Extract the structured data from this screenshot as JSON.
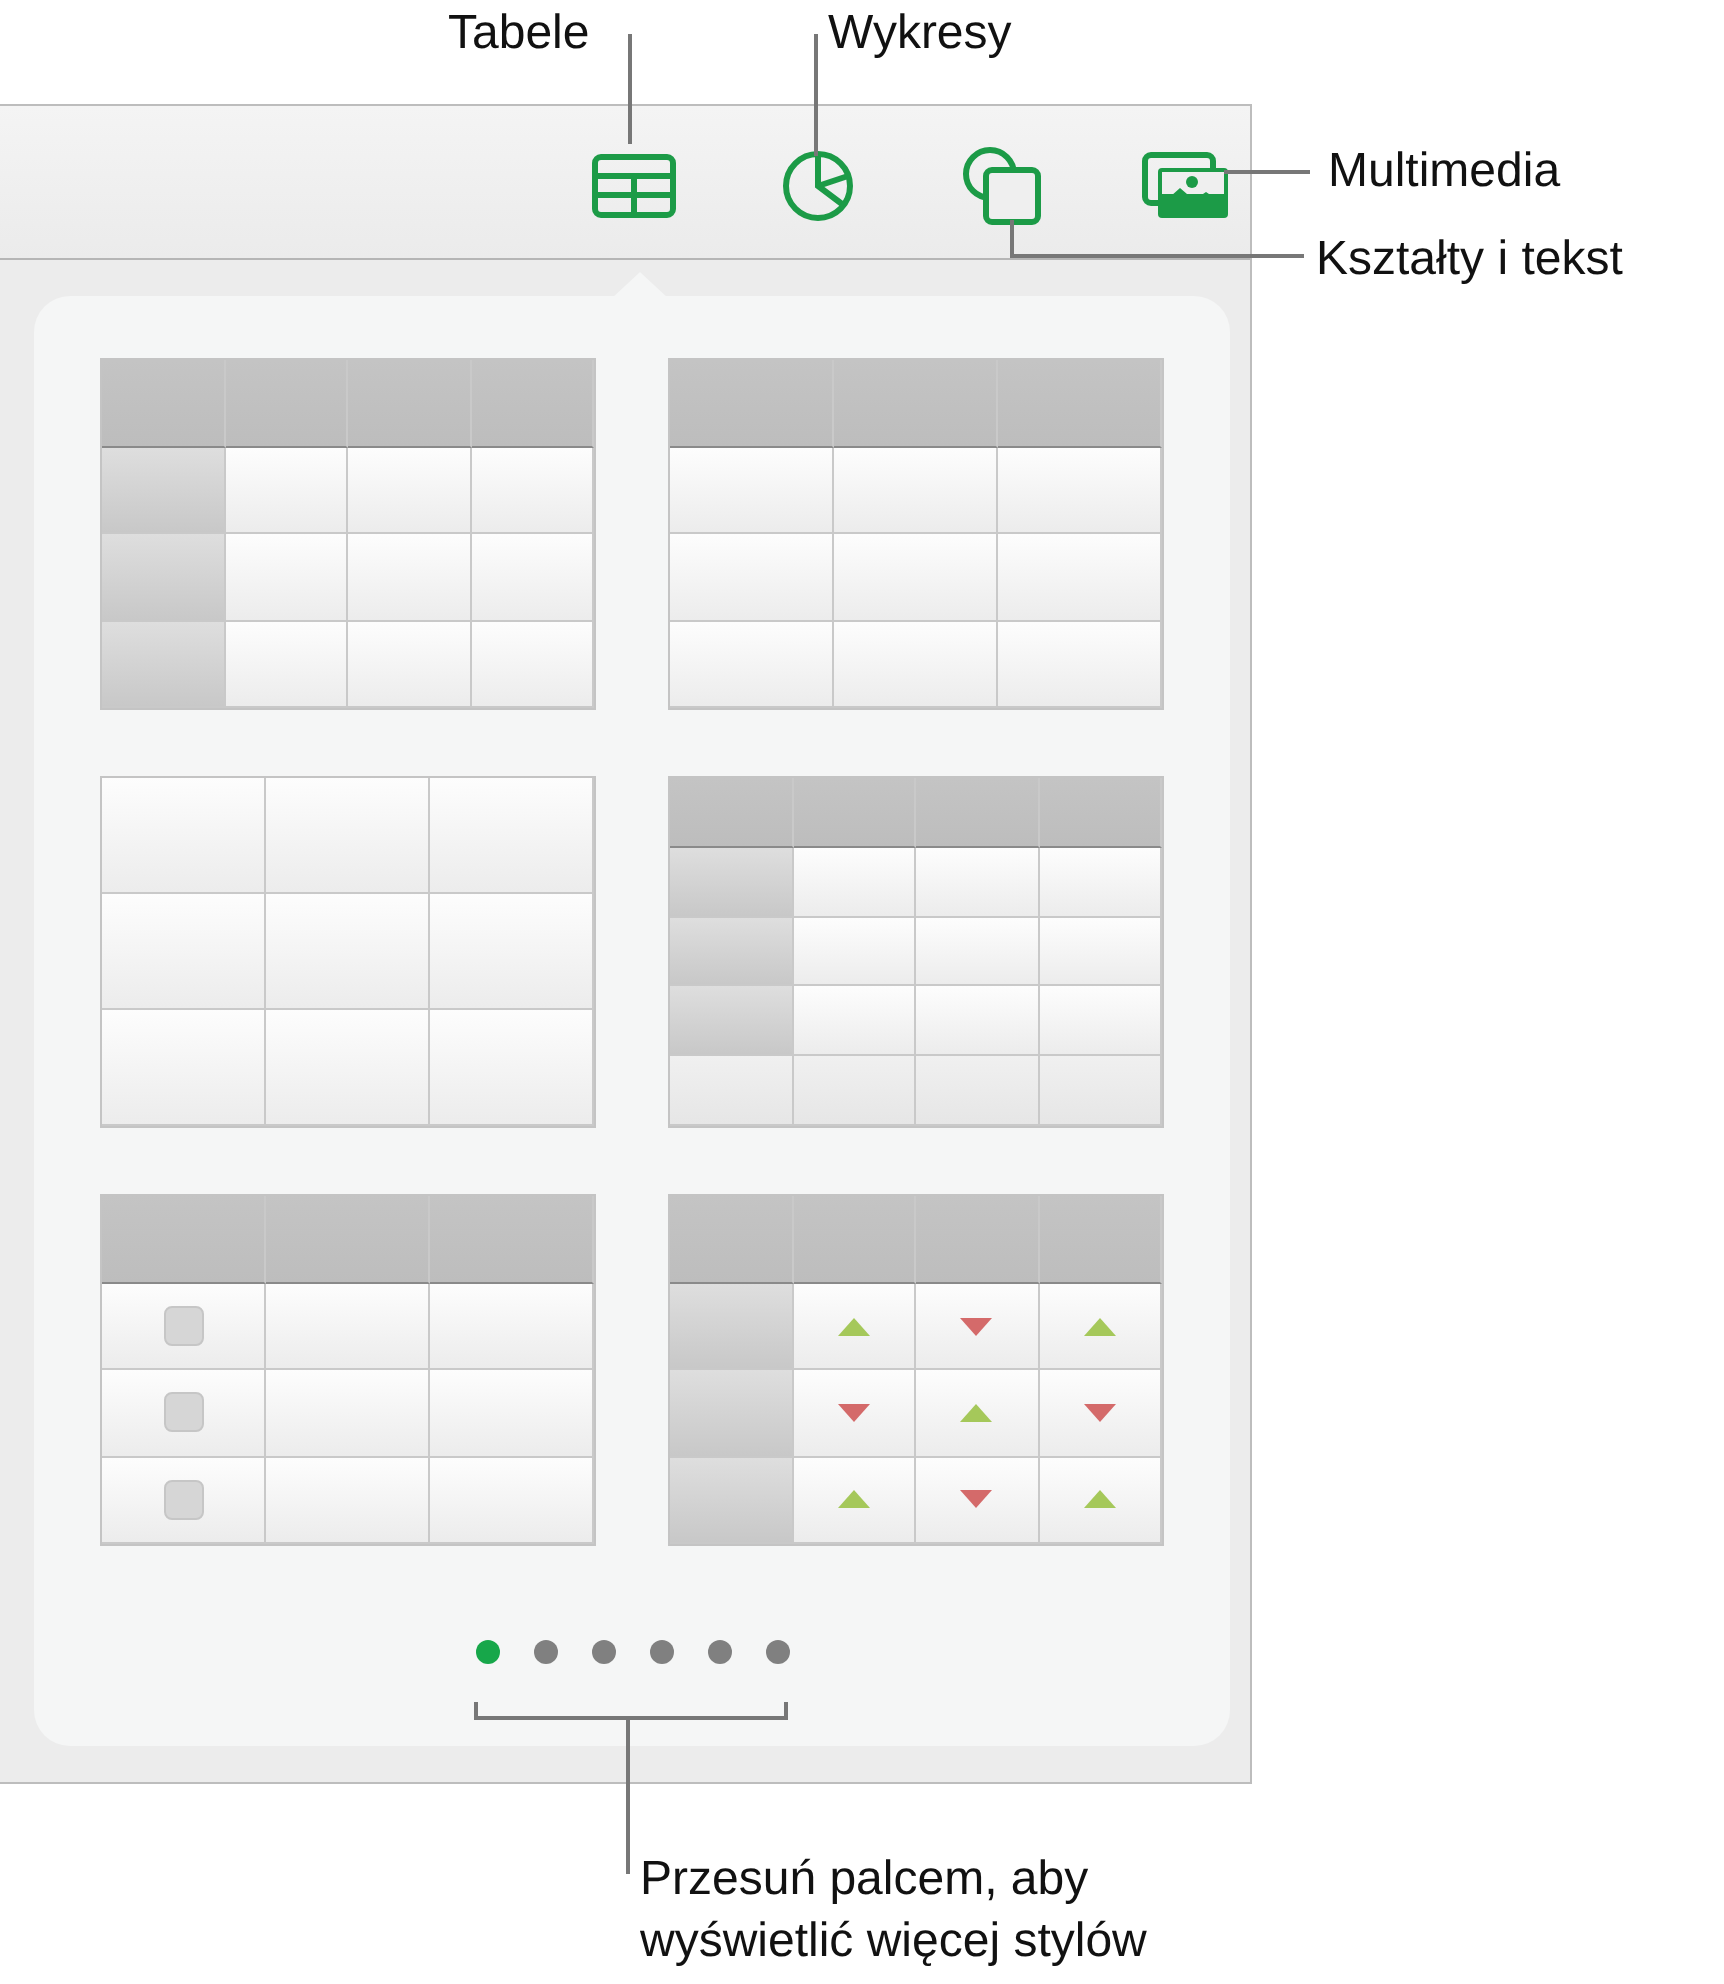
{
  "callouts": {
    "tables": "Tabele",
    "charts": "Wykresy",
    "media": "Multimedia",
    "shapes": "Kształty i tekst",
    "swipe": "Przesuń palcem, aby wyświetlić więcej stylów"
  },
  "table_styles": [
    {
      "kind": "header-row-and-column"
    },
    {
      "kind": "header-row"
    },
    {
      "kind": "plain"
    },
    {
      "kind": "header-row-column-footer"
    },
    {
      "kind": "checklist",
      "checkboxes": [
        {
          "checked": false
        },
        {
          "checked": false
        },
        {
          "checked": false
        }
      ]
    },
    {
      "kind": "indicators",
      "cells": [
        [
          {
            "rising": true
          },
          {
            "rising": false
          },
          {
            "rising": true
          }
        ],
        [
          {
            "rising": false
          },
          {
            "rising": true
          },
          {
            "rising": false
          }
        ],
        [
          {
            "rising": true
          },
          {
            "rising": false
          },
          {
            "rising": true
          }
        ]
      ]
    }
  ],
  "page_dots": [
    {
      "selected": true
    },
    {
      "selected": false
    },
    {
      "selected": false
    },
    {
      "selected": false
    },
    {
      "selected": false
    },
    {
      "selected": false
    }
  ]
}
